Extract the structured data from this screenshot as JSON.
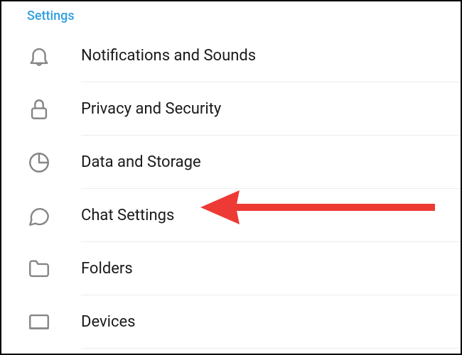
{
  "section_title": "Settings",
  "items": [
    {
      "label": "Notifications and Sounds",
      "icon": "bell-icon"
    },
    {
      "label": "Privacy and Security",
      "icon": "lock-icon"
    },
    {
      "label": "Data and Storage",
      "icon": "pie-chart-icon"
    },
    {
      "label": "Chat Settings",
      "icon": "chat-bubble-icon"
    },
    {
      "label": "Folders",
      "icon": "folder-icon"
    },
    {
      "label": "Devices",
      "icon": "device-icon"
    }
  ],
  "annotation": {
    "color": "#ee3a34",
    "target_item_index": 3
  }
}
